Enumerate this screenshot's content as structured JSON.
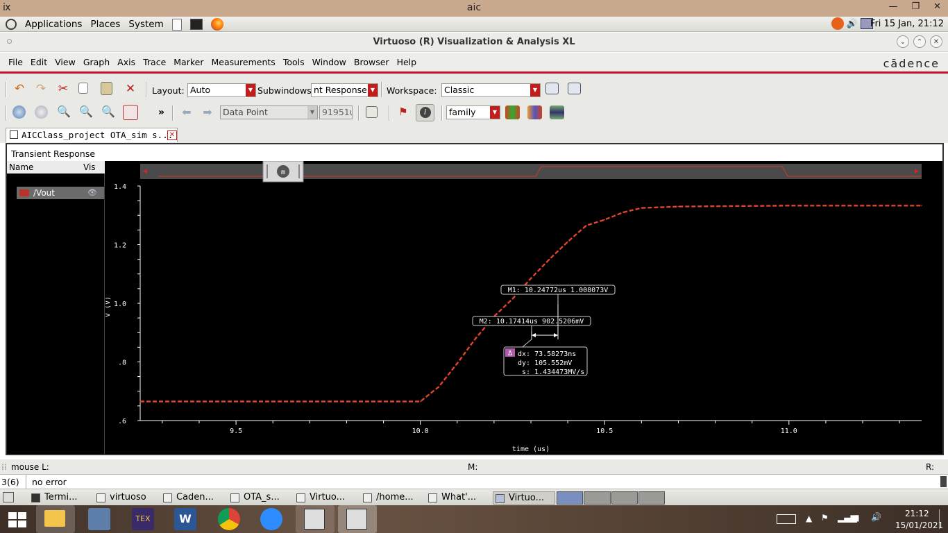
{
  "x_window": {
    "title": "aic"
  },
  "gnome_panel": {
    "menus": [
      "Applications",
      "Places",
      "System"
    ],
    "clock": "Fri 15 Jan, 21:12"
  },
  "app": {
    "title": "Virtuoso (R) Visualization & Analysis XL",
    "menus": [
      "File",
      "Edit",
      "View",
      "Graph",
      "Axis",
      "Trace",
      "Marker",
      "Measurements",
      "Tools",
      "Window",
      "Browser",
      "Help"
    ],
    "brand": "cādence"
  },
  "toolbar1": {
    "layout_label": "Layout:",
    "layout_value": "Auto",
    "subwindows_label": "Subwindows:",
    "subwindows_value": "nt Response",
    "workspace_label": "Workspace:",
    "workspace_value": "Classic"
  },
  "toolbar2": {
    "more": "»",
    "datapoint_value": "Data Point",
    "coord_value": "91951u",
    "family_value": "family"
  },
  "tab": {
    "label": "AICClass_project OTA_sim s..."
  },
  "plot": {
    "frame_title": "Transient Response",
    "legend_headers": {
      "name": "Name",
      "vis": "Vis"
    },
    "trace_name": "/Vout",
    "trace_color": "#e0442c",
    "markers": {
      "m1": "M1: 10.24772us 1.008073V",
      "m2": "M2: 10.17414us 902.5206mV",
      "delta_symbol": "Δ",
      "dx": "dx: 73.58273ns",
      "dy": "dy: 105.552mV",
      "s": "s: 1.434473MV/s"
    },
    "scroller_label": "m"
  },
  "chart_data": {
    "type": "line",
    "title": "Transient Response",
    "xlabel": "time (us)",
    "ylabel": "V (V)",
    "xlim": [
      9.24,
      11.36
    ],
    "ylim": [
      0.6,
      1.4
    ],
    "x_ticks": [
      "9.5",
      "10.0",
      "10.5",
      "11.0"
    ],
    "y_ticks": [
      "1.4",
      "1.2",
      "1.0",
      ".8",
      ".6"
    ],
    "grid": false,
    "series": [
      {
        "name": "/Vout",
        "color": "#e0442c",
        "x": [
          9.24,
          10.0,
          10.05,
          10.1,
          10.15,
          10.2,
          10.25,
          10.3,
          10.35,
          10.4,
          10.45,
          10.5,
          10.55,
          10.6,
          10.7,
          11.0,
          11.36
        ],
        "y": [
          0.665,
          0.665,
          0.715,
          0.795,
          0.88,
          0.955,
          1.015,
          1.085,
          1.15,
          1.21,
          1.265,
          1.285,
          1.31,
          1.325,
          1.33,
          1.333,
          1.333
        ]
      }
    ]
  },
  "status": {
    "mouse": "mouse L:",
    "middle": "M:",
    "right": "R:",
    "cmd_index": "3(6)",
    "message": "no error"
  },
  "taskbar_gnome": {
    "tasks": [
      "Termi...",
      "virtuoso",
      "Caden...",
      "OTA_s...",
      "Virtuo...",
      "/home...",
      "What'...",
      "Virtuo..."
    ]
  },
  "win_taskbar": {
    "time": "21:12",
    "date": "15/01/2021"
  }
}
